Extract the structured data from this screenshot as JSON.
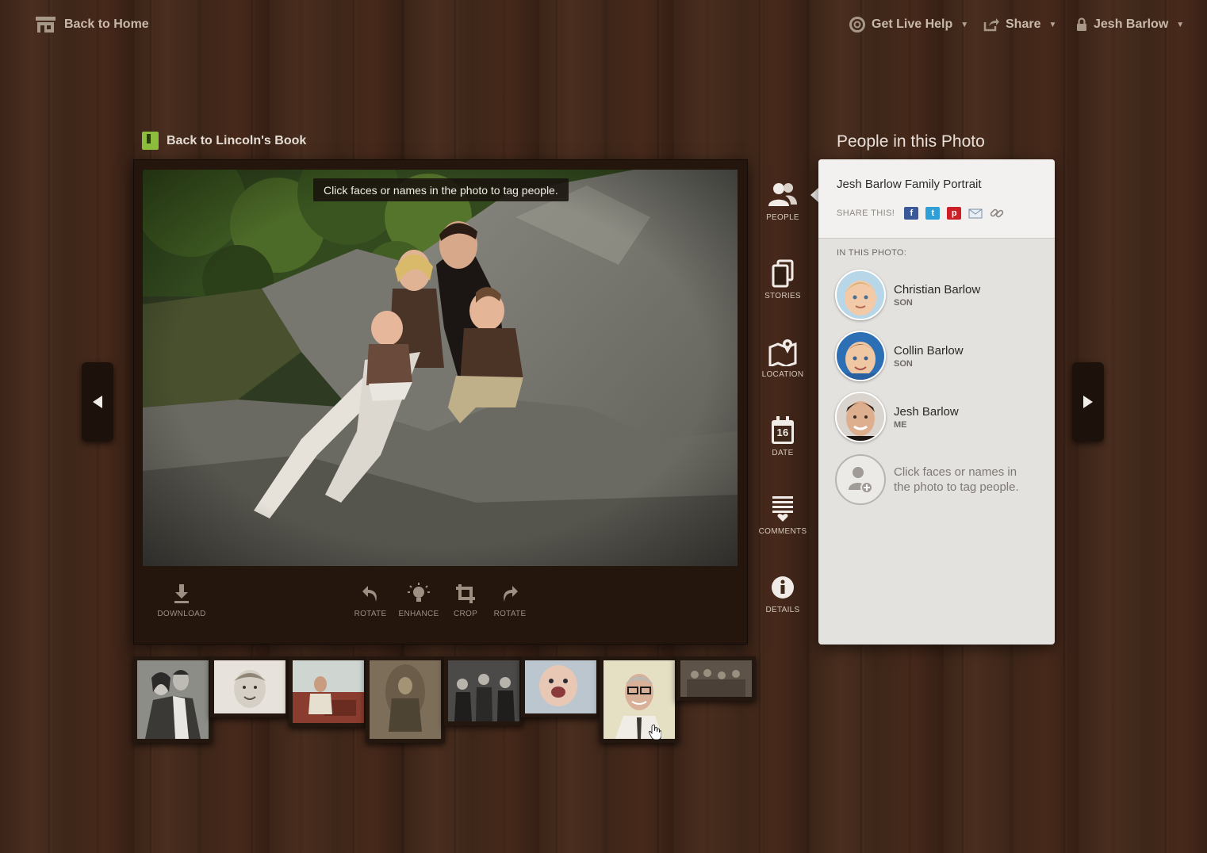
{
  "topbar": {
    "home_label": "Back to Home",
    "help_label": "Get Live Help",
    "share_label": "Share",
    "user_label": "Jesh Barlow"
  },
  "back_book_label": "Back to Lincoln's Book",
  "viewer": {
    "tag_tip": "Click faces or names in the photo to tag people.",
    "tools": {
      "download": "DOWNLOAD",
      "rotate_left": "ROTATE",
      "enhance": "ENHANCE",
      "crop": "CROP",
      "rotate_right": "ROTATE"
    }
  },
  "side_tabs": {
    "people": "PEOPLE",
    "stories": "STORIES",
    "location": "LOCATION",
    "date": "DATE",
    "date_day": "16",
    "comments": "COMMENTS",
    "details": "DETAILS"
  },
  "panel": {
    "heading": "People in this Photo",
    "photo_title": "Jesh Barlow Family Portrait",
    "share_label": "SHARE THIS!",
    "in_photo_label": "IN THIS PHOTO:",
    "people": [
      {
        "name": "Christian Barlow",
        "relation": "SON"
      },
      {
        "name": "Collin Barlow",
        "relation": "SON"
      },
      {
        "name": "Jesh Barlow",
        "relation": "ME"
      }
    ],
    "add_hint": "Click faces or names in the photo to tag people."
  },
  "colors": {
    "accent_green": "#8cbd3c",
    "facebook": "#3b5998",
    "twitter": "#2f9fd8",
    "pinterest": "#cb2027"
  }
}
